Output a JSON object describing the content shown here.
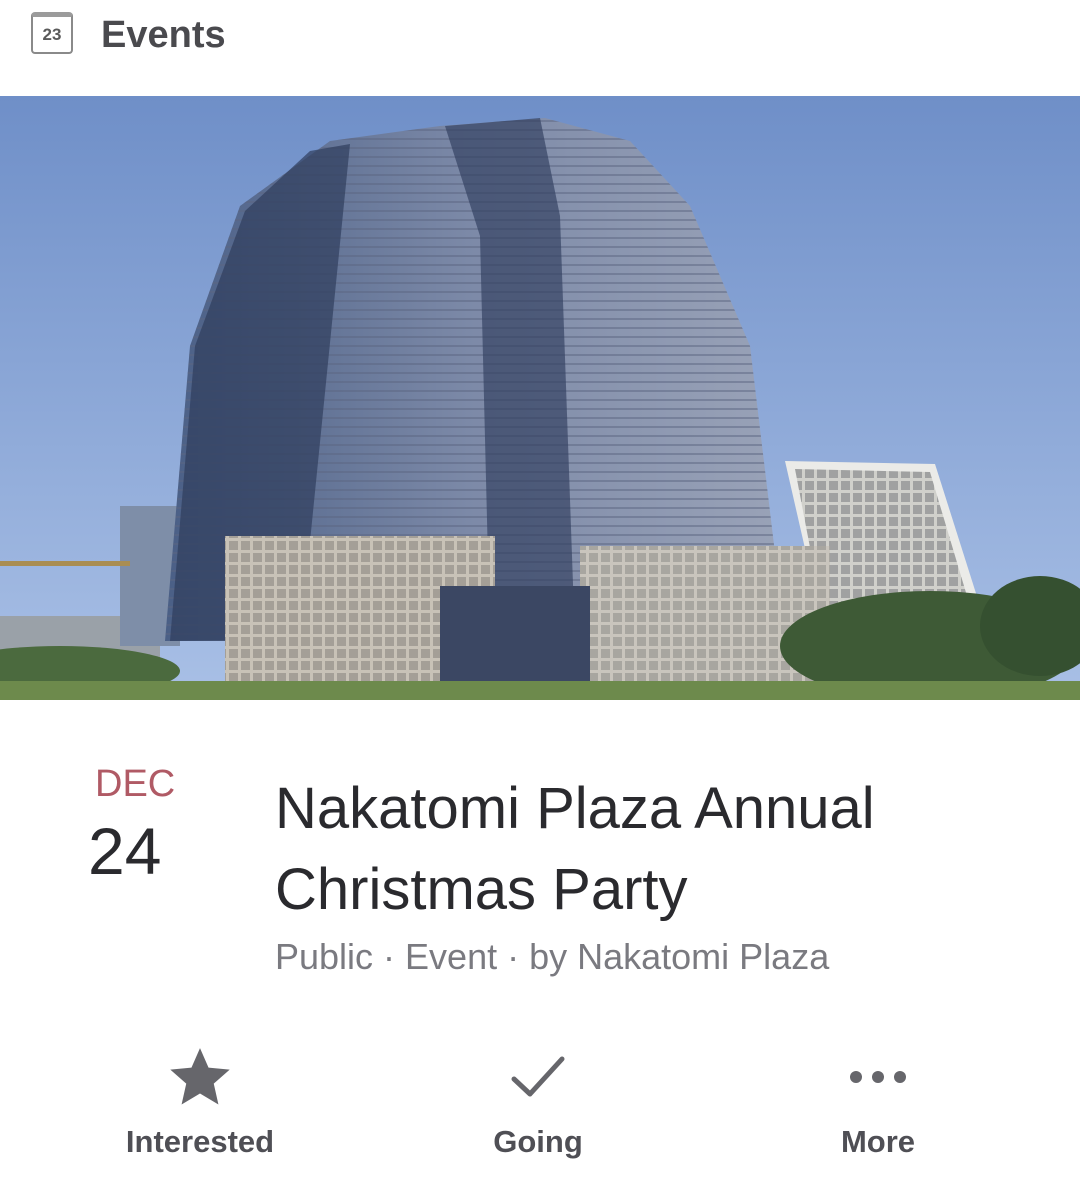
{
  "header": {
    "calendar_icon": "calendar-icon",
    "calendar_day": "23",
    "title": "Events"
  },
  "cover": {
    "image": "nakatomi-plaza-tower-photo"
  },
  "event": {
    "month": "DEC",
    "day": "24",
    "title": "Nakatomi Plaza Annual Christmas Party",
    "meta": "Public · Event · by Nakatomi Plaza"
  },
  "actions": [
    {
      "icon": "star-icon",
      "label": "Interested"
    },
    {
      "icon": "checkmark-icon",
      "label": "Going"
    },
    {
      "icon": "more-dots-icon",
      "label": "More"
    }
  ],
  "colors": {
    "month_accent": "#b05a65",
    "icon_gray": "#66666b",
    "sky": "#7f9fd0"
  }
}
